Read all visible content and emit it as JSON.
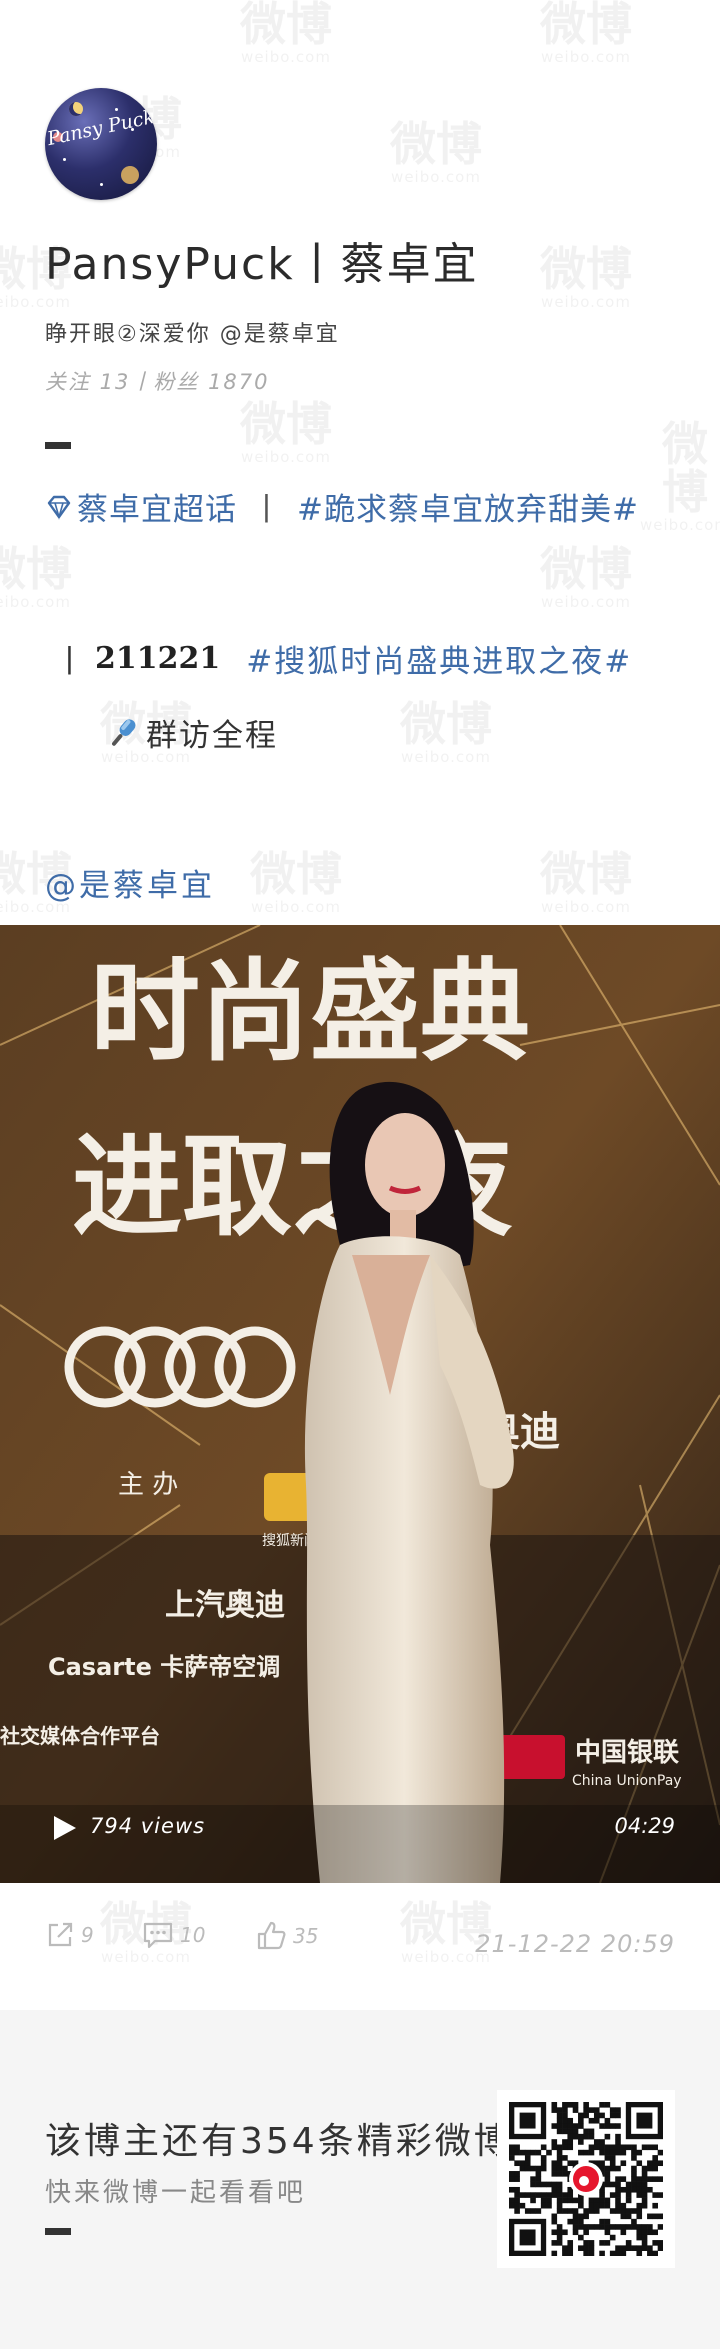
{
  "watermark": {
    "text": "微博",
    "subtext": "weibo.com"
  },
  "profile": {
    "avatar_text": "Pansy Puck",
    "name": "PansyPuck丨蔡卓宜",
    "bio": "睁开眼②深爱你  @是蔡卓宜",
    "stats": "关注 13丨粉丝 1870"
  },
  "post": {
    "topics": [
      "蔡卓宜超话",
      "#跪求蔡卓宜放弃甜美#"
    ],
    "topic_separator": "丨",
    "event_bar": "丨",
    "event_date": "211221",
    "event_tag": "#搜狐时尚盛典进取之夜#",
    "interview_label": "群访全程",
    "mention": "@是蔡卓宜"
  },
  "video": {
    "views": "794 views",
    "duration": "04:29",
    "backdrop_text": {
      "line1": "时尚盛典",
      "line2": "进取之夜",
      "brand": "奥迪",
      "host": "主 办",
      "sohu": "搜狐新闻",
      "saic": "上汽奥迪",
      "casarte": "Casarte 卡萨帝空调",
      "unionpay_cn": "中国银联",
      "unionpay_en": "China UnionPay",
      "media": "社交媒体合作平台"
    }
  },
  "actions": {
    "reposts": "9",
    "comments": "10",
    "likes": "35",
    "timestamp": "21-12-22 20:59"
  },
  "footer": {
    "title": "该博主还有354条精彩微博",
    "subtitle": "快来微博一起看看吧"
  },
  "colors": {
    "link": "#3f6ca8",
    "muted": "#bbbbbb",
    "footer_bg": "#f5f5f5"
  }
}
